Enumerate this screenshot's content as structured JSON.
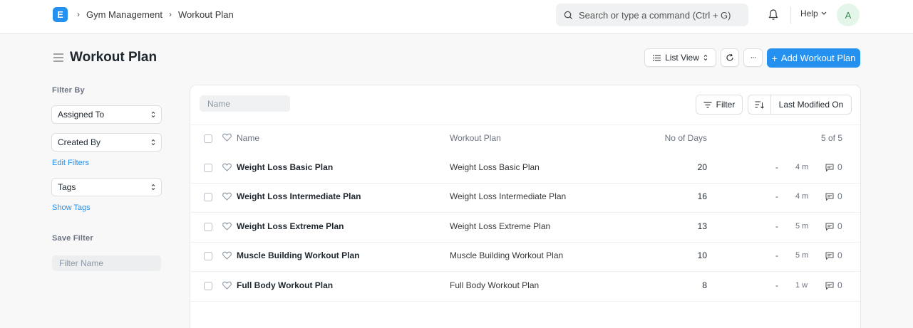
{
  "navbar": {
    "logo_letter": "E",
    "breadcrumbs": [
      "Gym Management",
      "Workout Plan"
    ],
    "search_placeholder": "Search or type a command (Ctrl + G)",
    "help_label": "Help",
    "avatar_letter": "A"
  },
  "page": {
    "title": "Workout Plan",
    "list_view_label": "List View",
    "more_label": "···",
    "add_label": "Add Workout Plan"
  },
  "sidebar": {
    "filter_by_label": "Filter By",
    "assigned_to": "Assigned To",
    "created_by": "Created By",
    "edit_filters": "Edit Filters",
    "tags": "Tags",
    "show_tags": "Show Tags",
    "save_filter_label": "Save Filter",
    "filter_name_placeholder": "Filter Name"
  },
  "list": {
    "name_placeholder": "Name",
    "filter_label": "Filter",
    "sort_label": "Last Modified On",
    "columns": {
      "name": "Name",
      "plan": "Workout Plan",
      "days": "No of Days",
      "count": "5 of 5"
    },
    "rows": [
      {
        "name": "Weight Loss Basic Plan",
        "plan": "Weight Loss Basic Plan",
        "days": "20",
        "dash": "-",
        "time": "4 m",
        "comments": "0"
      },
      {
        "name": "Weight Loss Intermediate Plan",
        "plan": "Weight Loss Intermediate Plan",
        "days": "16",
        "dash": "-",
        "time": "4 m",
        "comments": "0"
      },
      {
        "name": "Weight Loss Extreme Plan",
        "plan": "Weight Loss Extreme Plan",
        "days": "13",
        "dash": "-",
        "time": "5 m",
        "comments": "0"
      },
      {
        "name": "Muscle Building Workout Plan",
        "plan": "Muscle Building Workout Plan",
        "days": "10",
        "dash": "-",
        "time": "5 m",
        "comments": "0"
      },
      {
        "name": "Full Body Workout Plan",
        "plan": "Full Body Workout Plan",
        "days": "8",
        "dash": "-",
        "time": "1 w",
        "comments": "0"
      }
    ]
  },
  "colors": {
    "primary": "#2490ef",
    "background": "#f8f8f8",
    "text": "#1f272e"
  }
}
